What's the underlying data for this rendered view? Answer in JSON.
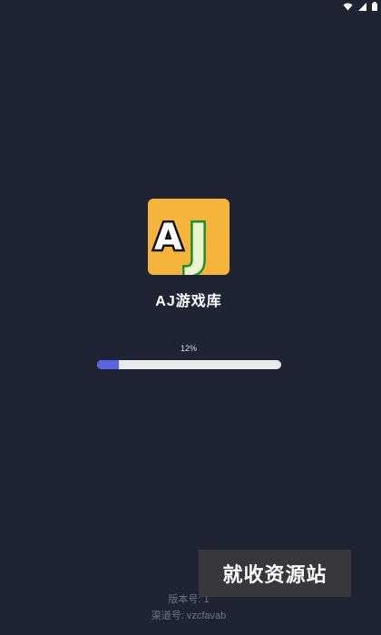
{
  "app": {
    "name": "AJ游戏库",
    "icon_letters": "AJ",
    "icon_bg_color": "#f6b43a"
  },
  "progress": {
    "label": "12%",
    "value": 0.12,
    "fill_color": "#5a63e6",
    "track_color": "#e9eaee"
  },
  "footer": {
    "version": "版本号: 1",
    "channel": "渠道号: vzcfavab"
  },
  "watermark": {
    "text": "就收资源站"
  },
  "status_bar": {
    "icons": [
      "wifi-icon",
      "signal-icon",
      "battery-icon"
    ]
  },
  "colors": {
    "background": "#202333"
  }
}
